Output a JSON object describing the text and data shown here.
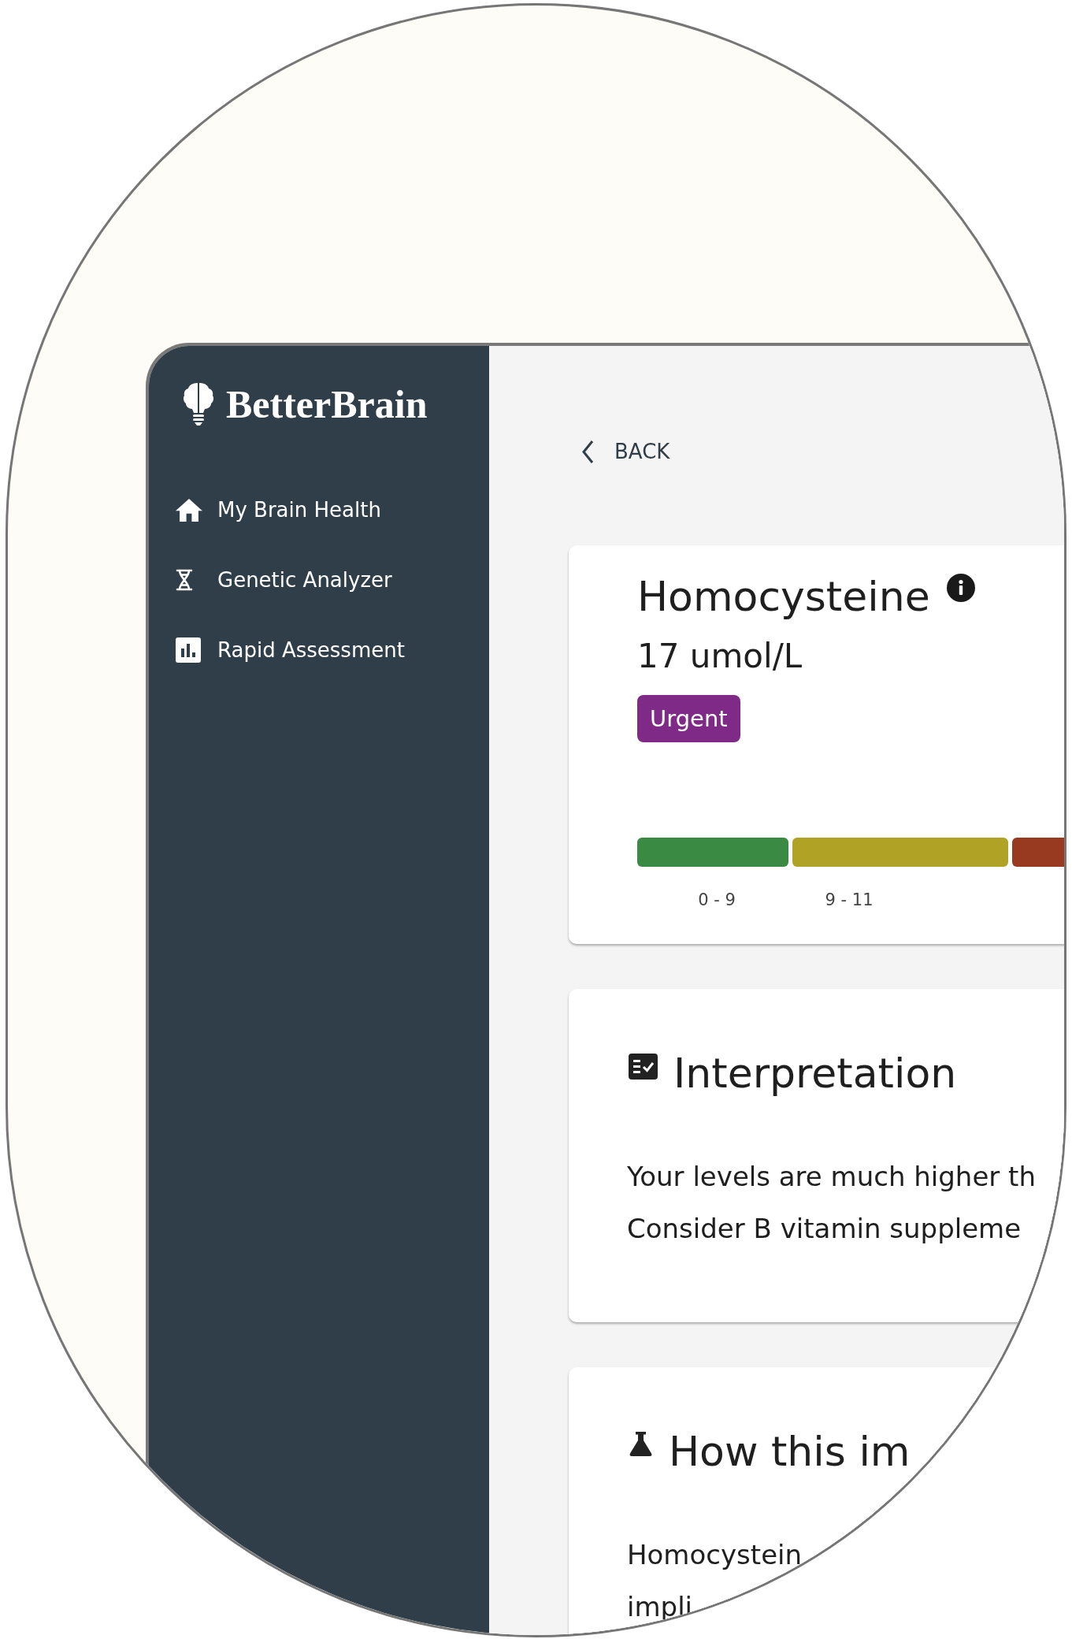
{
  "sidebar": {
    "logo": "BetterBrain",
    "items": [
      {
        "label": "My Brain Health"
      },
      {
        "label": "Genetic Analyzer"
      },
      {
        "label": "Rapid Assessment"
      }
    ]
  },
  "back": {
    "label": "BACK"
  },
  "marker": {
    "name": "Homocysteine",
    "value": "17 umol/L",
    "status": "Urgent",
    "ranges": [
      {
        "label": "0 - 9",
        "color": "#3a8a44"
      },
      {
        "label": "9 - 11",
        "color": "#b0a224"
      },
      {
        "color": "#973a20"
      }
    ]
  },
  "sections": [
    {
      "title": "Interpretation",
      "lines": [
        "Your levels are much higher th",
        "Consider B vitamin suppleme"
      ]
    },
    {
      "title": "How this im",
      "lines": [
        "Homocystein",
        "impli"
      ]
    }
  ]
}
